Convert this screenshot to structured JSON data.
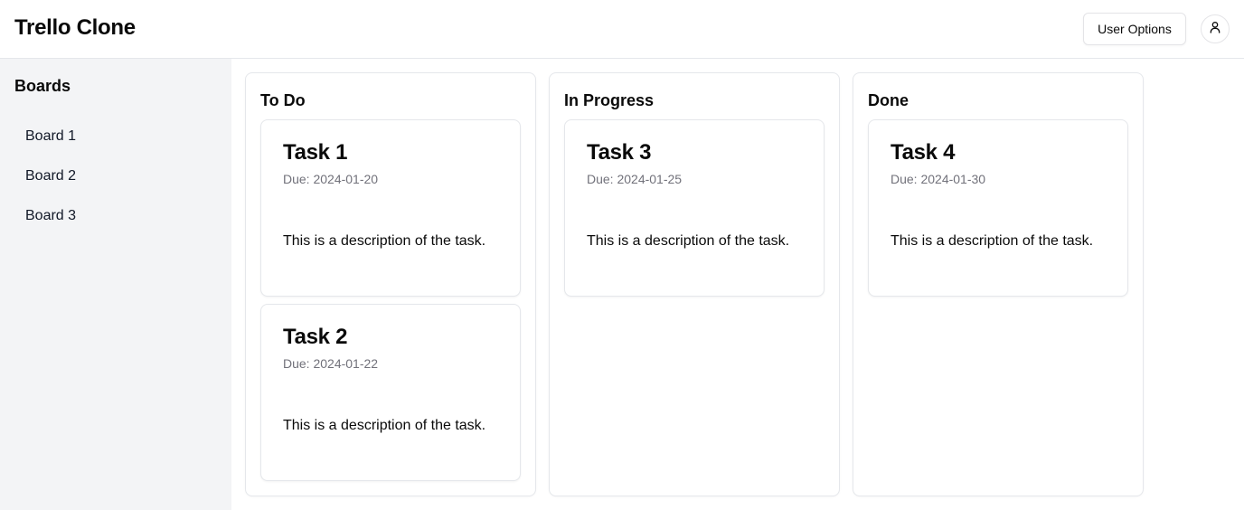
{
  "header": {
    "title": "Trello Clone",
    "user_options_label": "User Options",
    "avatar_icon": "user-icon"
  },
  "sidebar": {
    "heading": "Boards",
    "items": [
      {
        "label": "Board 1"
      },
      {
        "label": "Board 2"
      },
      {
        "label": "Board 3"
      }
    ]
  },
  "columns": [
    {
      "title": "To Do",
      "cards": [
        {
          "title": "Task 1",
          "due": "Due: 2024-01-20",
          "description": "This is a description of the task."
        },
        {
          "title": "Task 2",
          "due": "Due: 2024-01-22",
          "description": "This is a description of the task."
        }
      ]
    },
    {
      "title": "In Progress",
      "cards": [
        {
          "title": "Task 3",
          "due": "Due: 2024-01-25",
          "description": "This is a description of the task."
        }
      ]
    },
    {
      "title": "Done",
      "cards": [
        {
          "title": "Task 4",
          "due": "Due: 2024-01-30",
          "description": "This is a description of the task."
        }
      ]
    }
  ],
  "colors": {
    "sidebar_bg": "#f3f4f6",
    "border": "#e5e7eb",
    "muted_text": "#71717a",
    "text": "#0a0a0a"
  }
}
